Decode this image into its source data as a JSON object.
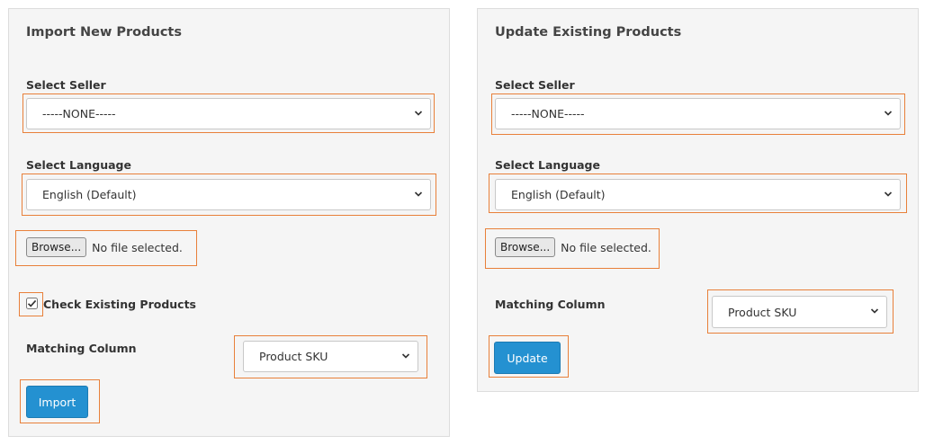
{
  "colors": {
    "panel_bg": "#f5f5f5",
    "highlight": "#e8803a",
    "primary": "#2491d1"
  },
  "import_panel": {
    "title": "Import New Products",
    "seller_label": "Select Seller",
    "seller_value": "-----NONE-----",
    "language_label": "Select Language",
    "language_value": "English (Default)",
    "browse_label": "Browse...",
    "file_status": "No file selected.",
    "check_existing_label": "Check Existing Products",
    "check_existing_checked": true,
    "matching_label": "Matching Column",
    "matching_value": "Product SKU",
    "import_label": "Import"
  },
  "update_panel": {
    "title": "Update Existing Products",
    "seller_label": "Select Seller",
    "seller_value": "-----NONE-----",
    "language_label": "Select Language",
    "language_value": "English (Default)",
    "browse_label": "Browse...",
    "file_status": "No file selected.",
    "matching_label": "Matching Column",
    "matching_value": "Product SKU",
    "update_label": "Update"
  },
  "icons": {
    "dropdown": "chevron-down-icon",
    "checkbox": "checkmark-icon"
  }
}
